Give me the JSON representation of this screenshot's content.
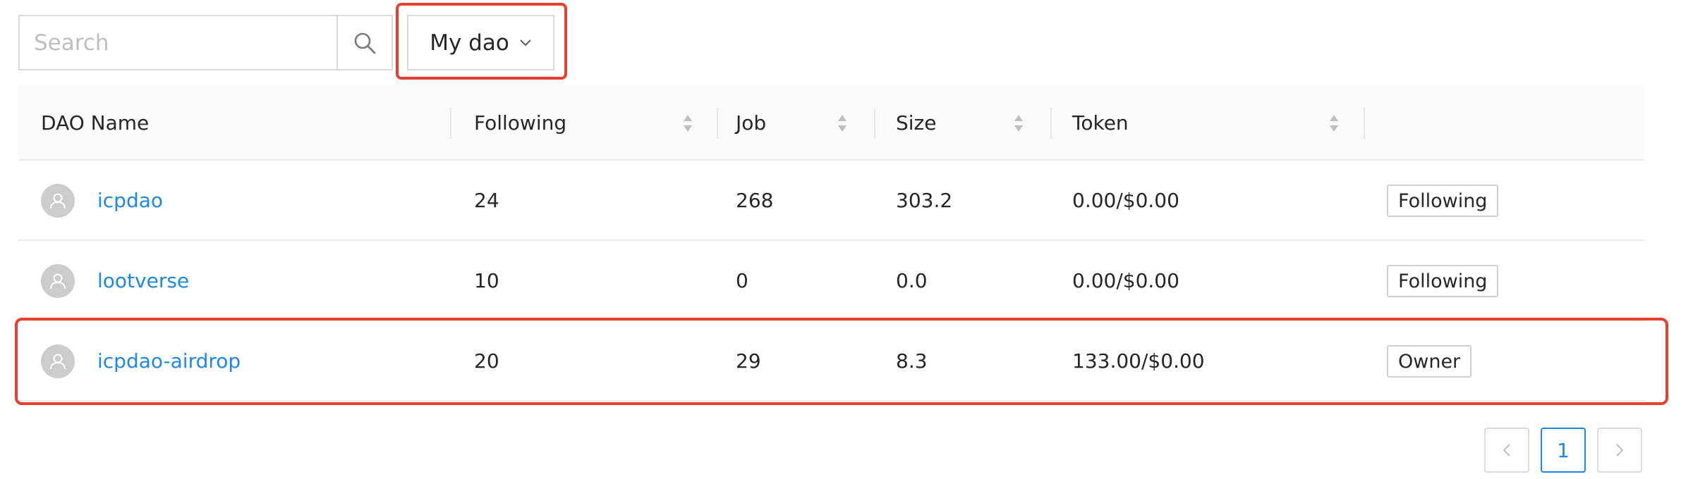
{
  "toolbar": {
    "search_placeholder": "Search",
    "search_value": "",
    "search_icon": "search-icon",
    "filter_selected": "My dao",
    "filter_icon": "chevron-down-icon"
  },
  "table": {
    "columns": [
      {
        "label": "DAO Name",
        "sortable": false
      },
      {
        "label": "Following",
        "sortable": true
      },
      {
        "label": "Job",
        "sortable": true
      },
      {
        "label": "Size",
        "sortable": true
      },
      {
        "label": "Token",
        "sortable": true
      },
      {
        "label": "",
        "sortable": false
      }
    ],
    "rows": [
      {
        "name": "icpdao",
        "following": "24",
        "job": "268",
        "size": "303.2",
        "token": "0.00/$0.00",
        "status": "Following"
      },
      {
        "name": "lootverse",
        "following": "10",
        "job": "0",
        "size": "0.0",
        "token": "0.00/$0.00",
        "status": "Following"
      },
      {
        "name": "icpdao-airdrop",
        "following": "20",
        "job": "29",
        "size": "8.3",
        "token": "133.00/$0.00",
        "status": "Owner"
      }
    ]
  },
  "pagination": {
    "prev_icon": "chevron-left-icon",
    "current_page": "1",
    "next_icon": "chevron-right-icon"
  },
  "colors": {
    "link": "#1e88e5",
    "highlight": "#e8402f",
    "header_bg": "#fafafa"
  }
}
